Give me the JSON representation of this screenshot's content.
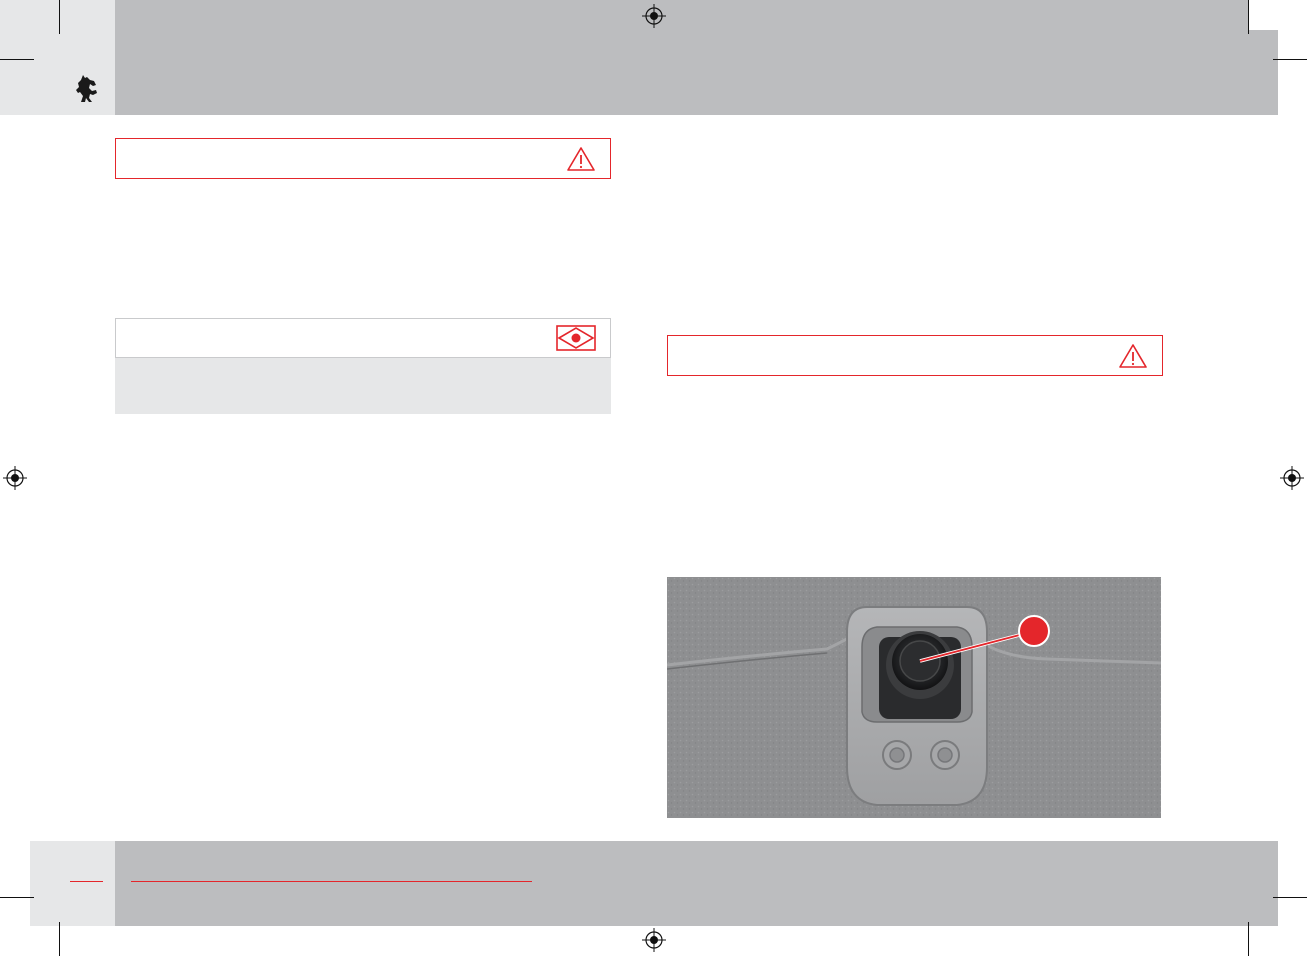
{
  "page": {
    "brand_logo": "prancing-horse-logo",
    "marks": [
      "registration-mark",
      "crop-mark"
    ]
  },
  "left_column": {
    "warning_box": {
      "icon": "warning-triangle-icon"
    },
    "note_box": {
      "icon": "eye-note-icon"
    }
  },
  "right_column": {
    "warning_box": {
      "icon": "warning-triangle-icon"
    },
    "figure": {
      "description_icon": "callout-marker",
      "accent_color": "#e4262b"
    }
  },
  "colors": {
    "band": "#bcbdbf",
    "tab": "#e6e7e8",
    "accent": "#e4262b"
  }
}
